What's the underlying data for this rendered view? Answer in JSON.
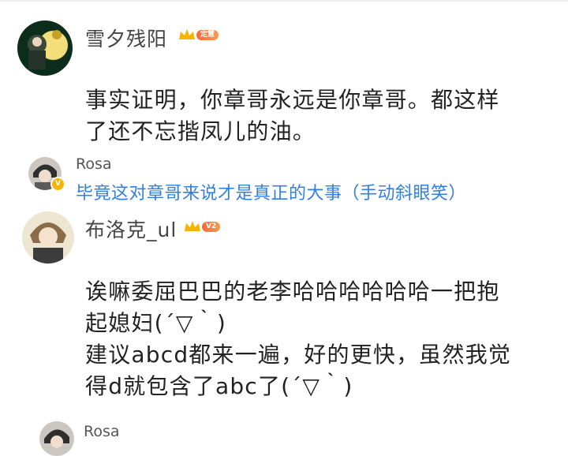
{
  "comments": [
    {
      "username": "雪夕残阳",
      "badge": "定慧",
      "text_lines": [
        "事实证明，你章哥永远是你章哥。都这样",
        "了还不忘揩凤儿的油。"
      ],
      "reply": {
        "username": "Rosa",
        "text": "毕竟这对章哥来说才是真正的大事（手动斜眼笑）"
      }
    },
    {
      "username": "布洛克_ul",
      "badge": "V2",
      "text_lines": [
        "诶嘛委屈巴巴的老李哈哈哈哈哈哈一把抱",
        "起媳妇(´▽｀)",
        "建议abcd都来一遍，好的更快，虽然我觉",
        "得d就包含了abc了(´▽｀)"
      ],
      "reply": {
        "username": "Rosa"
      }
    }
  ],
  "colors": {
    "reply_text": "#2f7fe6",
    "badge_orange": "#f26a3a",
    "crown": "#f6b400"
  }
}
